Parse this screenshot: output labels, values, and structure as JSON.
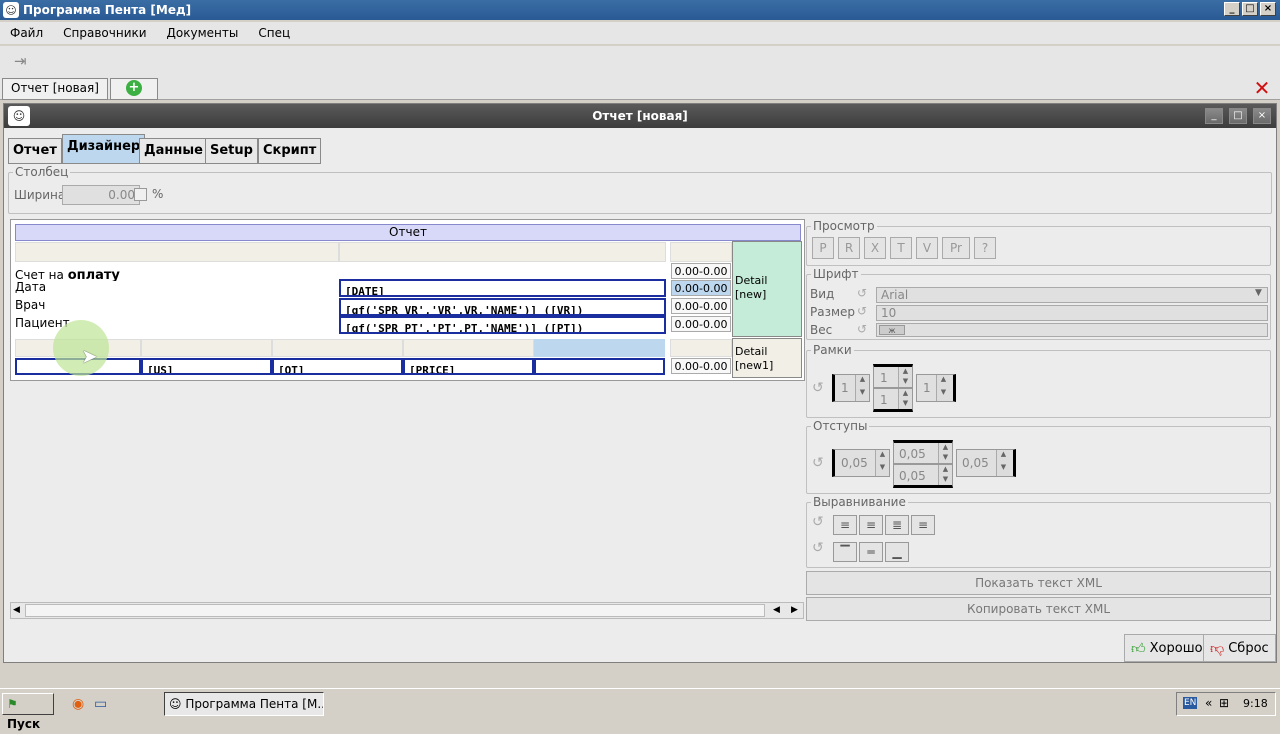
{
  "window": {
    "title": "Программа Пента [Мед]"
  },
  "menu": [
    "Файл",
    "Справочники",
    "Документы",
    "Спец"
  ],
  "doc_tabs": {
    "active": "Отчет [новая]"
  },
  "inner": {
    "title": "Отчет [новая]"
  },
  "tabs": [
    "Отчет",
    "Дизайнер",
    "Данные",
    "Setup",
    "Скрипт"
  ],
  "active_tab": "Дизайнер",
  "column_group": {
    "title": "Столбец",
    "width_label": "Ширина",
    "width_value": "0.00",
    "percent_label": "%"
  },
  "designer": {
    "header": "Отчет",
    "rows": [
      {
        "label": "Счет на",
        "label2": "оплату",
        "field": "",
        "range": "0.00-0.00"
      },
      {
        "label": "Дата",
        "field": "[DATE]",
        "range": "0.00-0.00"
      },
      {
        "label": "Врач",
        "field": "[gf('SPR_VR','VR',VR,'NAME')] ([VR])",
        "range": "0.00-0.00"
      },
      {
        "label": "Пациент",
        "field": "[gf('SPR_PT','PT',PT,'NAME')] ([PT])",
        "range": "0.00-0.00"
      }
    ],
    "detail1": "Detail\n[new]",
    "detail2": "Detail\n[new1]",
    "row2_fields": [
      "",
      "[US]",
      "[QT]",
      "[PRICE]",
      ""
    ],
    "row2_range": "0.00-0.00"
  },
  "right": {
    "preview_title": "Просмотр",
    "preview_buttons": [
      "P",
      "R",
      "X",
      "T",
      "V",
      "Pr",
      "?"
    ],
    "font_title": "Шрифт",
    "font_view_label": "Вид",
    "font_view_value": "Arial",
    "font_size_label": "Размер",
    "font_size_value": "10",
    "font_weight_label": "Вес",
    "font_weight_value": "ж",
    "borders_title": "Рамки",
    "borders": [
      "1",
      "1",
      "1",
      "1"
    ],
    "padding_title": "Отступы",
    "padding": [
      "0,05",
      "0,05",
      "0,05",
      "0,05"
    ],
    "align_title": "Выравнивание",
    "show_xml": "Показать текст XML",
    "copy_xml": "Копировать текст XML"
  },
  "buttons": {
    "ok": "Хорошо",
    "reset": "Сброс"
  },
  "taskbar": {
    "start": "Пуск",
    "task": "Программа Пента [М...",
    "lang": "EN",
    "time": "9:18"
  }
}
